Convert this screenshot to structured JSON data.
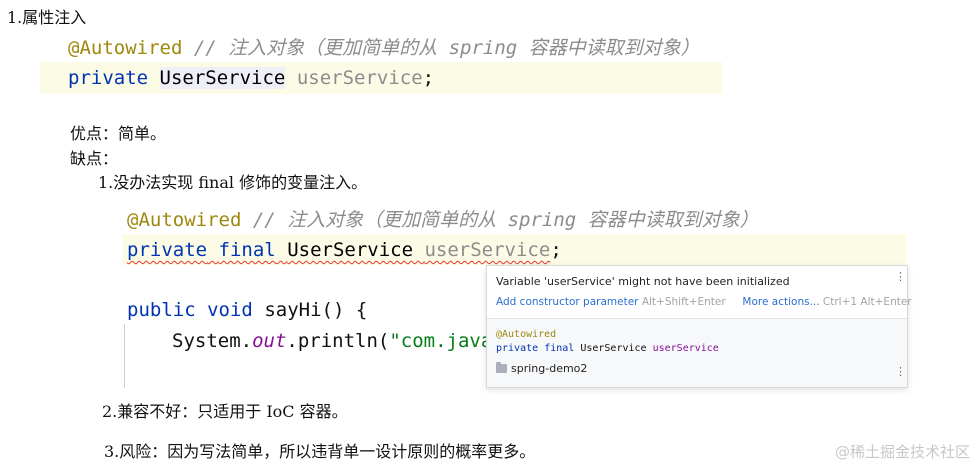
{
  "section1": {
    "heading": "1.属性注入",
    "code": {
      "annotation": "@Autowired",
      "comment": "// 注入对象（更加简单的从 spring 容器中读取到对象）",
      "kw_private": "private",
      "type": "UserService",
      "field": "userService",
      "semicolon": ";"
    }
  },
  "pros": "优点：简单。",
  "cons": "缺点：",
  "con1": {
    "text": "1.没办法实现 final 修饰的变量注入。",
    "code": {
      "annotation": "@Autowired",
      "comment": "// 注入对象（更加简单的从 spring 容器中读取到对象）",
      "kw_private": "private",
      "kw_final": "final",
      "type": "UserService",
      "field": "userService",
      "semicolon": ";",
      "kw_public": "public",
      "kw_void": "void",
      "method": "sayHi() {",
      "print_prefix": "System.",
      "print_out": "out",
      "print_mid": ".println(",
      "print_str": "\"com.java"
    }
  },
  "popup": {
    "message": "Variable 'userService' might not have been initialized",
    "action1": "Add constructor parameter",
    "shortcut1": "Alt+Shift+Enter",
    "action2": "More actions...",
    "shortcut2": "Ctrl+1 Alt+Enter",
    "code_annotation": "@Autowired",
    "code_private": "private",
    "code_final": "final",
    "code_type": "UserService",
    "code_field": "userService",
    "module": "spring-demo2"
  },
  "con2": "2.兼容不好：只适用于 IoC 容器。",
  "con3": "3.风险：因为写法简单，所以违背单一设计原则的概率更多。",
  "watermark": "@稀土掘金技术社区"
}
